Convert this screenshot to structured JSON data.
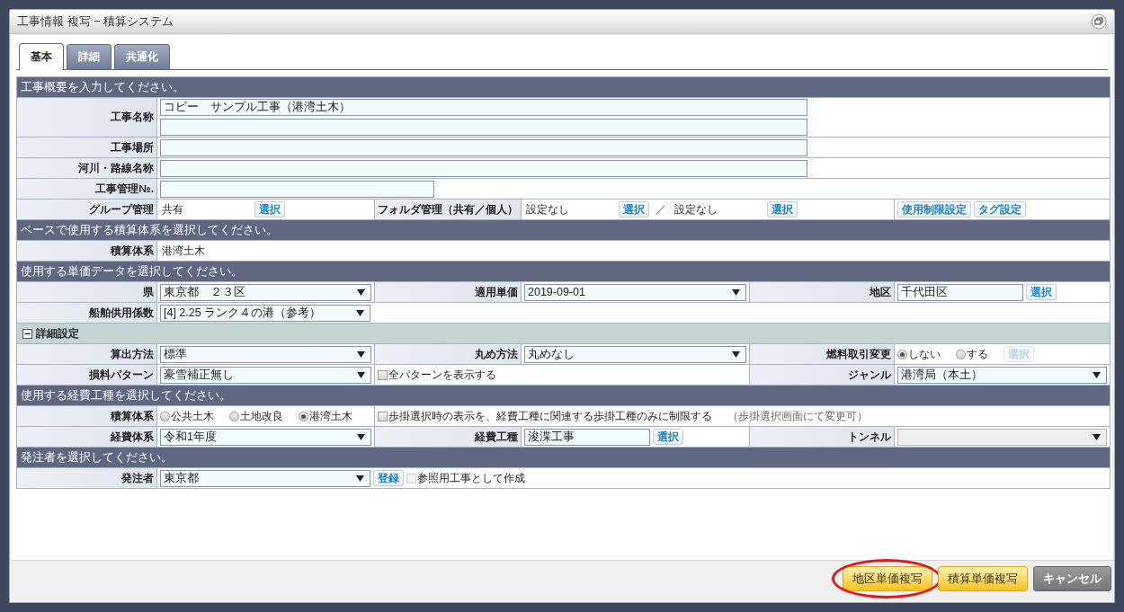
{
  "window": {
    "title": "工事情報 複写 − 積算システム"
  },
  "tabs": [
    {
      "label": "基本",
      "selected": true
    },
    {
      "label": "詳細",
      "selected": false
    },
    {
      "label": "共通化",
      "selected": false
    }
  ],
  "sections": [
    {
      "kind": "section",
      "title": "工事概要を入力してください。",
      "rows": [
        [
          {
            "kind": "label",
            "text": "工事名称"
          },
          {
            "kind": "value",
            "controls": [
              {
                "kind": "wide-input",
                "value": "コピー　サンプル工事（港湾土木）"
              },
              {
                "kind": "wide-input"
              }
            ]
          },
          "",
          "",
          "",
          ""
        ],
        [
          {
            "kind": "label",
            "text": "工事場所"
          },
          {
            "kind": "value",
            "controls": [
              {
                "kind": "wide-input"
              }
            ]
          },
          "",
          "",
          "",
          ""
        ],
        [
          {
            "kind": "label",
            "text": "河川・路線名称"
          },
          {
            "kind": "value",
            "controls": [
              {
                "kind": "wide-input"
              }
            ]
          },
          "",
          "",
          "",
          ""
        ],
        [
          {
            "kind": "label",
            "text": "工事管理№."
          },
          {
            "kind": "value",
            "controls": [
              {
                "kind": "input"
              }
            ]
          },
          "",
          "",
          "",
          ""
        ],
        [
          {
            "kind": "label",
            "text": "グループ管理"
          },
          {
            "kind": "value",
            "controls": [
              {
                "kind": "text",
                "text": "共有"
              },
              {
                "kind": "button",
                "label": "選択",
                "disabled": false
              }
            ]
          },
          {
            "kind": "label",
            "text": "フォルダ管理（共有／個人）"
          },
          {
            "kind": "value",
            "controls": [
              {
                "kind": "text",
                "text": "設定なし"
              },
              {
                "kind": "button",
                "label": "選択",
                "disabled": false
              },
              {
                "kind": "slash",
                "text": "／"
              },
              {
                "kind": "text",
                "text": "設定なし"
              },
              {
                "kind": "button",
                "label": "選択",
                "disabled": false
              }
            ]
          },
          "",
          {
            "kind": "value",
            "controls": [
              {
                "kind": "button",
                "label": "使用制限設定",
                "disabled": false
              },
              {
                "kind": "button",
                "label": "タグ設定",
                "disabled": false
              }
            ]
          }
        ]
      ]
    },
    {
      "kind": "section",
      "title": "ベースで使用する積算体系を選択してください。",
      "rows": [
        [
          {
            "kind": "label",
            "text": "積算体系"
          },
          {
            "kind": "value",
            "controls": [
              {
                "kind": "text",
                "text": "港湾土木"
              }
            ]
          },
          "",
          "",
          "",
          ""
        ]
      ]
    },
    {
      "kind": "section",
      "title": "使用する単価データを選択してください。",
      "rows": [
        [
          {
            "kind": "label",
            "text": "県"
          },
          {
            "kind": "value",
            "controls": [
              {
                "kind": "select",
                "value": "東京都　２３区",
                "disabled": false
              }
            ]
          },
          {
            "kind": "label",
            "text": "適用単価"
          },
          {
            "kind": "value",
            "controls": [
              {
                "kind": "select",
                "value": "2019-09-01",
                "disabled": false
              }
            ]
          },
          {
            "kind": "label",
            "text": "地区"
          },
          {
            "kind": "value",
            "controls": [
              {
                "kind": "short-input",
                "value": "千代田区"
              },
              {
                "kind": "button",
                "label": "選択",
                "disabled": false
              }
            ]
          }
        ],
        [
          {
            "kind": "label",
            "text": "船舶供用係数"
          },
          {
            "kind": "value",
            "controls": [
              {
                "kind": "select",
                "value": "[4] 2.25 ランク４の港（参考）",
                "disabled": false
              }
            ]
          },
          "",
          "",
          "",
          ""
        ]
      ]
    },
    {
      "kind": "subsection",
      "title": "詳細設定",
      "expanded": true,
      "rows": [
        [
          {
            "kind": "label",
            "text": "算出方法"
          },
          {
            "kind": "value",
            "controls": [
              {
                "kind": "select",
                "value": "標準",
                "disabled": false
              }
            ]
          },
          {
            "kind": "label",
            "text": "丸め方法"
          },
          {
            "kind": "value",
            "controls": [
              {
                "kind": "select",
                "value": "丸めなし",
                "disabled": false
              }
            ]
          },
          {
            "kind": "label",
            "text": "燃料取引変更"
          },
          {
            "kind": "value",
            "controls": [
              {
                "kind": "radio",
                "label": "しない",
                "selected": true
              },
              {
                "kind": "radio",
                "label": "する",
                "selected": false
              },
              {
                "kind": "button",
                "label": "選択",
                "disabled": true
              }
            ]
          }
        ],
        [
          {
            "kind": "label",
            "text": "損料パターン"
          },
          {
            "kind": "value",
            "controls": [
              {
                "kind": "select",
                "value": "豪雪補正無し",
                "disabled": false
              }
            ]
          },
          {
            "kind": "value",
            "controls": [
              {
                "kind": "checkbox",
                "label": "全パターンを表示する",
                "checked": false,
                "disabled": false
              }
            ]
          },
          "",
          {
            "kind": "label",
            "text": "ジャンル"
          },
          {
            "kind": "value",
            "controls": [
              {
                "kind": "select",
                "value": "港湾局（本土）",
                "disabled": false
              }
            ]
          }
        ]
      ]
    },
    {
      "kind": "section",
      "title": "使用する経費工種を選択してください。",
      "rows": [
        [
          {
            "kind": "label",
            "text": "積算体系"
          },
          {
            "kind": "value",
            "controls": [
              {
                "kind": "radio",
                "label": "公共土木",
                "selected": false
              },
              {
                "kind": "radio",
                "label": "土地改良",
                "selected": false
              },
              {
                "kind": "radio",
                "label": "港湾土木",
                "selected": true
              }
            ]
          },
          {
            "kind": "value",
            "controls": [
              {
                "kind": "checkbox",
                "label": "歩掛選択時の表示を、経費工種に関連する歩掛工種のみに制限する",
                "checked": false,
                "disabled": false
              },
              {
                "kind": "note",
                "text": "（歩掛選択画面にて変更可）"
              }
            ]
          },
          "",
          "",
          ""
        ],
        [
          {
            "kind": "label",
            "text": "経費体系"
          },
          {
            "kind": "value",
            "controls": [
              {
                "kind": "select",
                "value": "令和1年度",
                "disabled": false
              }
            ]
          },
          {
            "kind": "label",
            "text": "経費工種"
          },
          {
            "kind": "value",
            "controls": [
              {
                "kind": "short-input",
                "value": "浚渫工事"
              },
              {
                "kind": "button",
                "label": "選択",
                "disabled": false
              }
            ]
          },
          {
            "kind": "label",
            "text": "トンネル"
          },
          {
            "kind": "value",
            "controls": [
              {
                "kind": "select",
                "disabled": true
              }
            ]
          }
        ]
      ]
    },
    {
      "kind": "section",
      "title": "発注者を選択してください。",
      "rows": [
        [
          {
            "kind": "label",
            "text": "発注者"
          },
          {
            "kind": "value",
            "controls": [
              {
                "kind": "select",
                "value": "東京都",
                "disabled": false
              },
              {
                "kind": "button",
                "label": "登録",
                "disabled": false
              },
              {
                "kind": "checkbox",
                "label": "参照用工事として作成",
                "checked": false,
                "disabled": true
              }
            ]
          },
          "",
          "",
          "",
          ""
        ]
      ]
    }
  ],
  "footer_buttons": [
    {
      "kind": "primary",
      "label": "地区単価複写",
      "circled": true
    },
    {
      "kind": "primary",
      "label": "積算単価複写",
      "circled": false
    },
    {
      "kind": "secondary",
      "label": "キャンセル",
      "circled": false
    }
  ]
}
